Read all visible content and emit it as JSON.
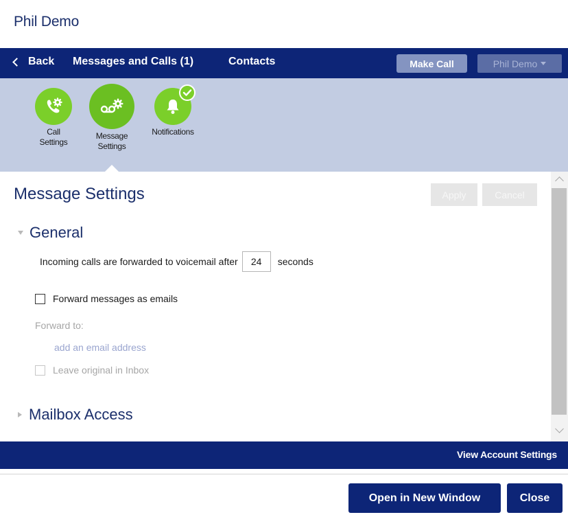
{
  "window": {
    "title": "Phil Demo"
  },
  "nav": {
    "back_label": "Back",
    "messages_label": "Messages and Calls (1)",
    "contacts_label": "Contacts",
    "make_call_label": "Make Call",
    "user_label": "Phil Demo"
  },
  "iconbar": {
    "items": [
      {
        "label_line1": "Call",
        "label_line2": "Settings",
        "icon": "phone-gear-icon"
      },
      {
        "label_line1": "Message",
        "label_line2": "Settings",
        "icon": "voicemail-gear-icon",
        "selected": true
      },
      {
        "label_line1": "Notifications",
        "label_line2": "",
        "icon": "bell-check-icon"
      }
    ]
  },
  "content": {
    "title": "Message Settings",
    "apply_label": "Apply",
    "cancel_label": "Cancel",
    "general": {
      "label": "General",
      "forward_prefix": "Incoming calls are forwarded to voicemail after",
      "forward_seconds": "24",
      "forward_suffix": "seconds",
      "forward_emails_label": "Forward messages as emails",
      "forward_emails_checked": false,
      "forward_to_label": "Forward to:",
      "add_email_label": "add an email address",
      "leave_original_label": "Leave original in Inbox",
      "leave_original_checked": false
    },
    "mailbox_access_label": "Mailbox Access"
  },
  "footer": {
    "view_account_label": "View Account Settings",
    "open_window_label": "Open in New Window",
    "close_label": "Close"
  },
  "colors": {
    "nav_bg": "#0d2577",
    "icon_bar_bg": "#c2cce2",
    "accent_green": "#7bcf2a",
    "title_blue": "#1b2f6b"
  }
}
